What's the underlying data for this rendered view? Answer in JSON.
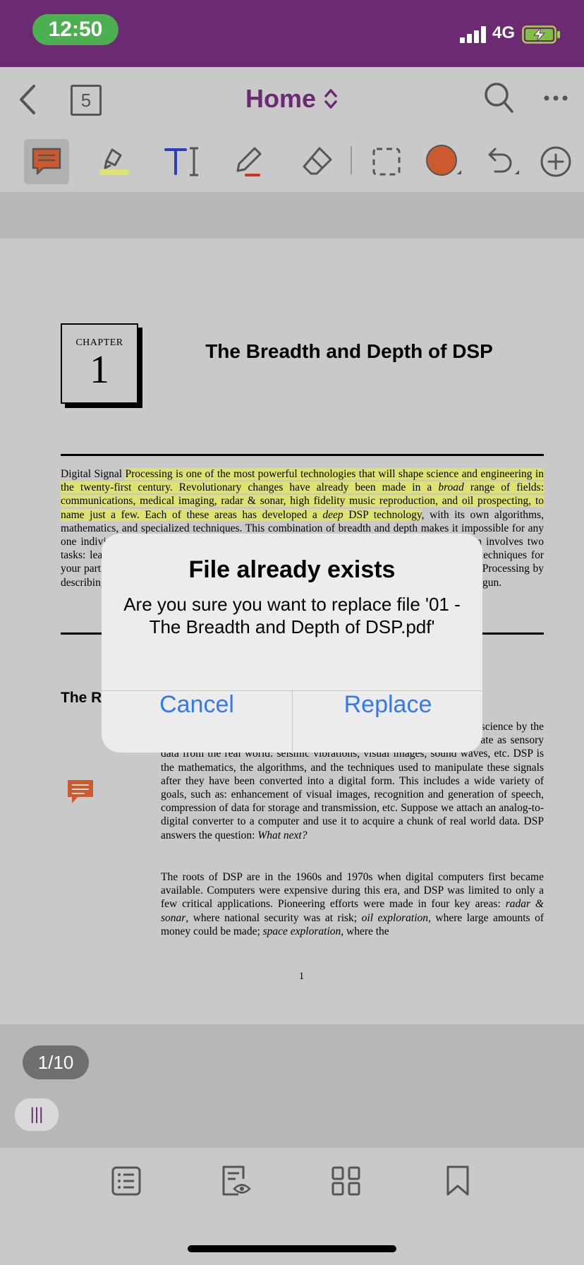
{
  "status_bar": {
    "time": "12:50",
    "network": "4G"
  },
  "nav": {
    "pages_count": "5",
    "title": "Home"
  },
  "toolbar": {
    "tools": [
      "comment-icon",
      "highlighter-icon",
      "text-icon",
      "pen-icon",
      "eraser-icon",
      "select-area-icon",
      "color-icon",
      "undo-icon",
      "add-icon"
    ],
    "highlight_color": "#dde270",
    "pen_color": "#cc3322",
    "fill_color": "#cc5a2f"
  },
  "document": {
    "chapter_label": "CHAPTER",
    "chapter_number": "1",
    "title": "The Breadth and Depth of DSP",
    "intro": {
      "lead": "Digital Signal ",
      "highlighted": "Processing is one of the most powerful technologies that will shape science and engineering in the twenty-first century. Revolutionary changes have already been made in a ",
      "broad": "broad",
      "highlighted2": " range of fields: communications, medical imaging, radar & sonar, high fidelity music reproduction, and oil prospecting, to name just a few. Each of these areas has developed a ",
      "deep": "deep",
      "highlighted3": " DSP technology",
      "rest": ", with its own algorithms, mathematics, and specialized techniques. This combination of breadth and depth makes it impossible for any one individual to master all of the DSP technology that has been developed. DSP education involves two tasks: learning general concepts that apply to the field as a whole, and learning specialized techniques for your particular area of interest. This chapter starts our journey into the world of Digital Signal Processing by describing the dramatic effect that DSP has made in several diverse fields. The revolution has begun."
    },
    "section_heading": "The Roots of DSP",
    "body_p1_a": "Digital Signal Processing is distinguished from other areas in computer science by the unique type of data it uses: signals. In most cases, these signals originate as sensory data from the real world: seismic vibrations, visual images, sound waves, etc. DSP is the mathematics, the algorithms, and the techniques used to manipulate these signals after they have been converted into a digital form. This includes a wide variety of goals, such as: enhancement of visual images, recognition and generation of speech, compression of data for storage and transmission, etc. Suppose we attach an analog-to-digital converter to a computer and use it to acquire a chunk of real world data. DSP answers the question: ",
    "body_p1_b": "What next?",
    "body_p2_a": "The roots of DSP are in the 1960s and 1970s when digital computers first became available. Computers were expensive during this era, and DSP was limited to only a few critical applications. Pioneering efforts were made in four key areas: ",
    "body_p2_b": "radar & sonar",
    "body_p2_c": ", where national security was at risk; ",
    "body_p2_d": "oil exploration",
    "body_p2_e": ", where large amounts of money could be made; ",
    "body_p2_f": "space exploration",
    "body_p2_g": ", where the",
    "page_number": "1"
  },
  "page_indicator": "1/10",
  "scroll_handle": "|||",
  "bottom_tabs": [
    "outline-icon",
    "reading-view-icon",
    "thumbnails-icon",
    "bookmark-icon"
  ],
  "dialog": {
    "title": "File already exists",
    "message": "Are you sure you want to replace file '01 - The Breadth and Depth of DSP.pdf'",
    "cancel_label": "Cancel",
    "replace_label": "Replace",
    "button_color": "#3478f6"
  }
}
